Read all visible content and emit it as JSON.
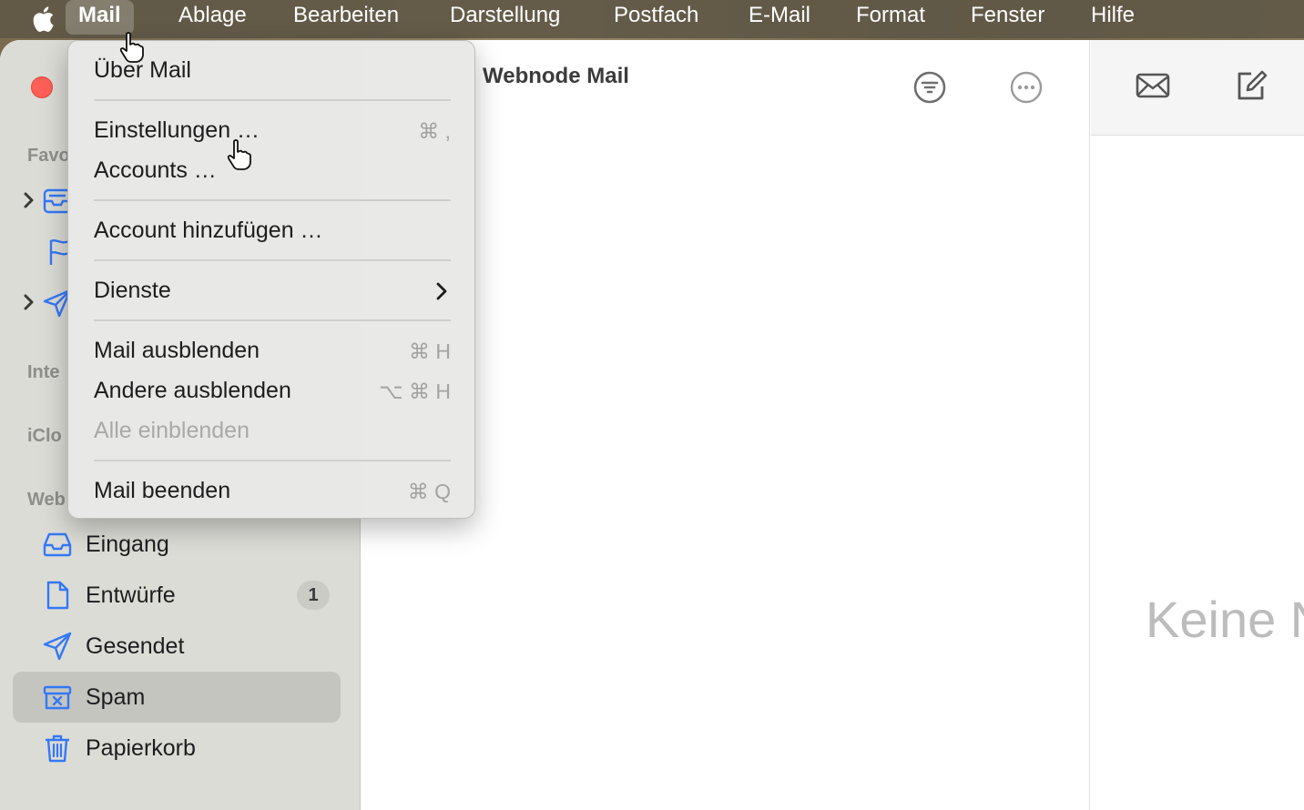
{
  "menubar": {
    "app_name": "Mail",
    "menus": [
      "Ablage",
      "Bearbeiten",
      "Darstellung",
      "Postfach",
      "E-Mail",
      "Format",
      "Fenster",
      "Hilfe"
    ]
  },
  "dropdown": {
    "about": "Über Mail",
    "settings": "Einstellungen …",
    "settings_shortcut": "⌘ ,",
    "accounts": "Accounts …",
    "add_account": "Account hinzufügen …",
    "services": "Dienste",
    "hide_mail": "Mail ausblenden",
    "hide_mail_shortcut": "⌘ H",
    "hide_others": "Andere ausblenden",
    "hide_others_shortcut": "⌥ ⌘ H",
    "show_all": "Alle einblenden",
    "quit": "Mail beenden",
    "quit_shortcut": "⌘ Q"
  },
  "sidebar": {
    "favorites_label": "Favo",
    "internal_label": "Inte",
    "icloud_label": "iClo",
    "webnode_label": "Web",
    "items": [
      {
        "label": "Eingang",
        "icon": "inbox-icon"
      },
      {
        "label": "Entwürfe",
        "icon": "draft-icon",
        "badge": "1"
      },
      {
        "label": "Gesendet",
        "icon": "paper-plane-icon"
      },
      {
        "label": "Spam",
        "icon": "junk-icon"
      },
      {
        "label": "Papierkorb",
        "icon": "trash-icon"
      }
    ]
  },
  "message_list": {
    "title": "Webnode Mail"
  },
  "viewer": {
    "empty_text": "Keine N"
  },
  "colors": {
    "accent": "#3478f6",
    "close": "#fe5f57",
    "sidebar_bg": "#dcdcd6",
    "selected": "#c5c5c0"
  }
}
